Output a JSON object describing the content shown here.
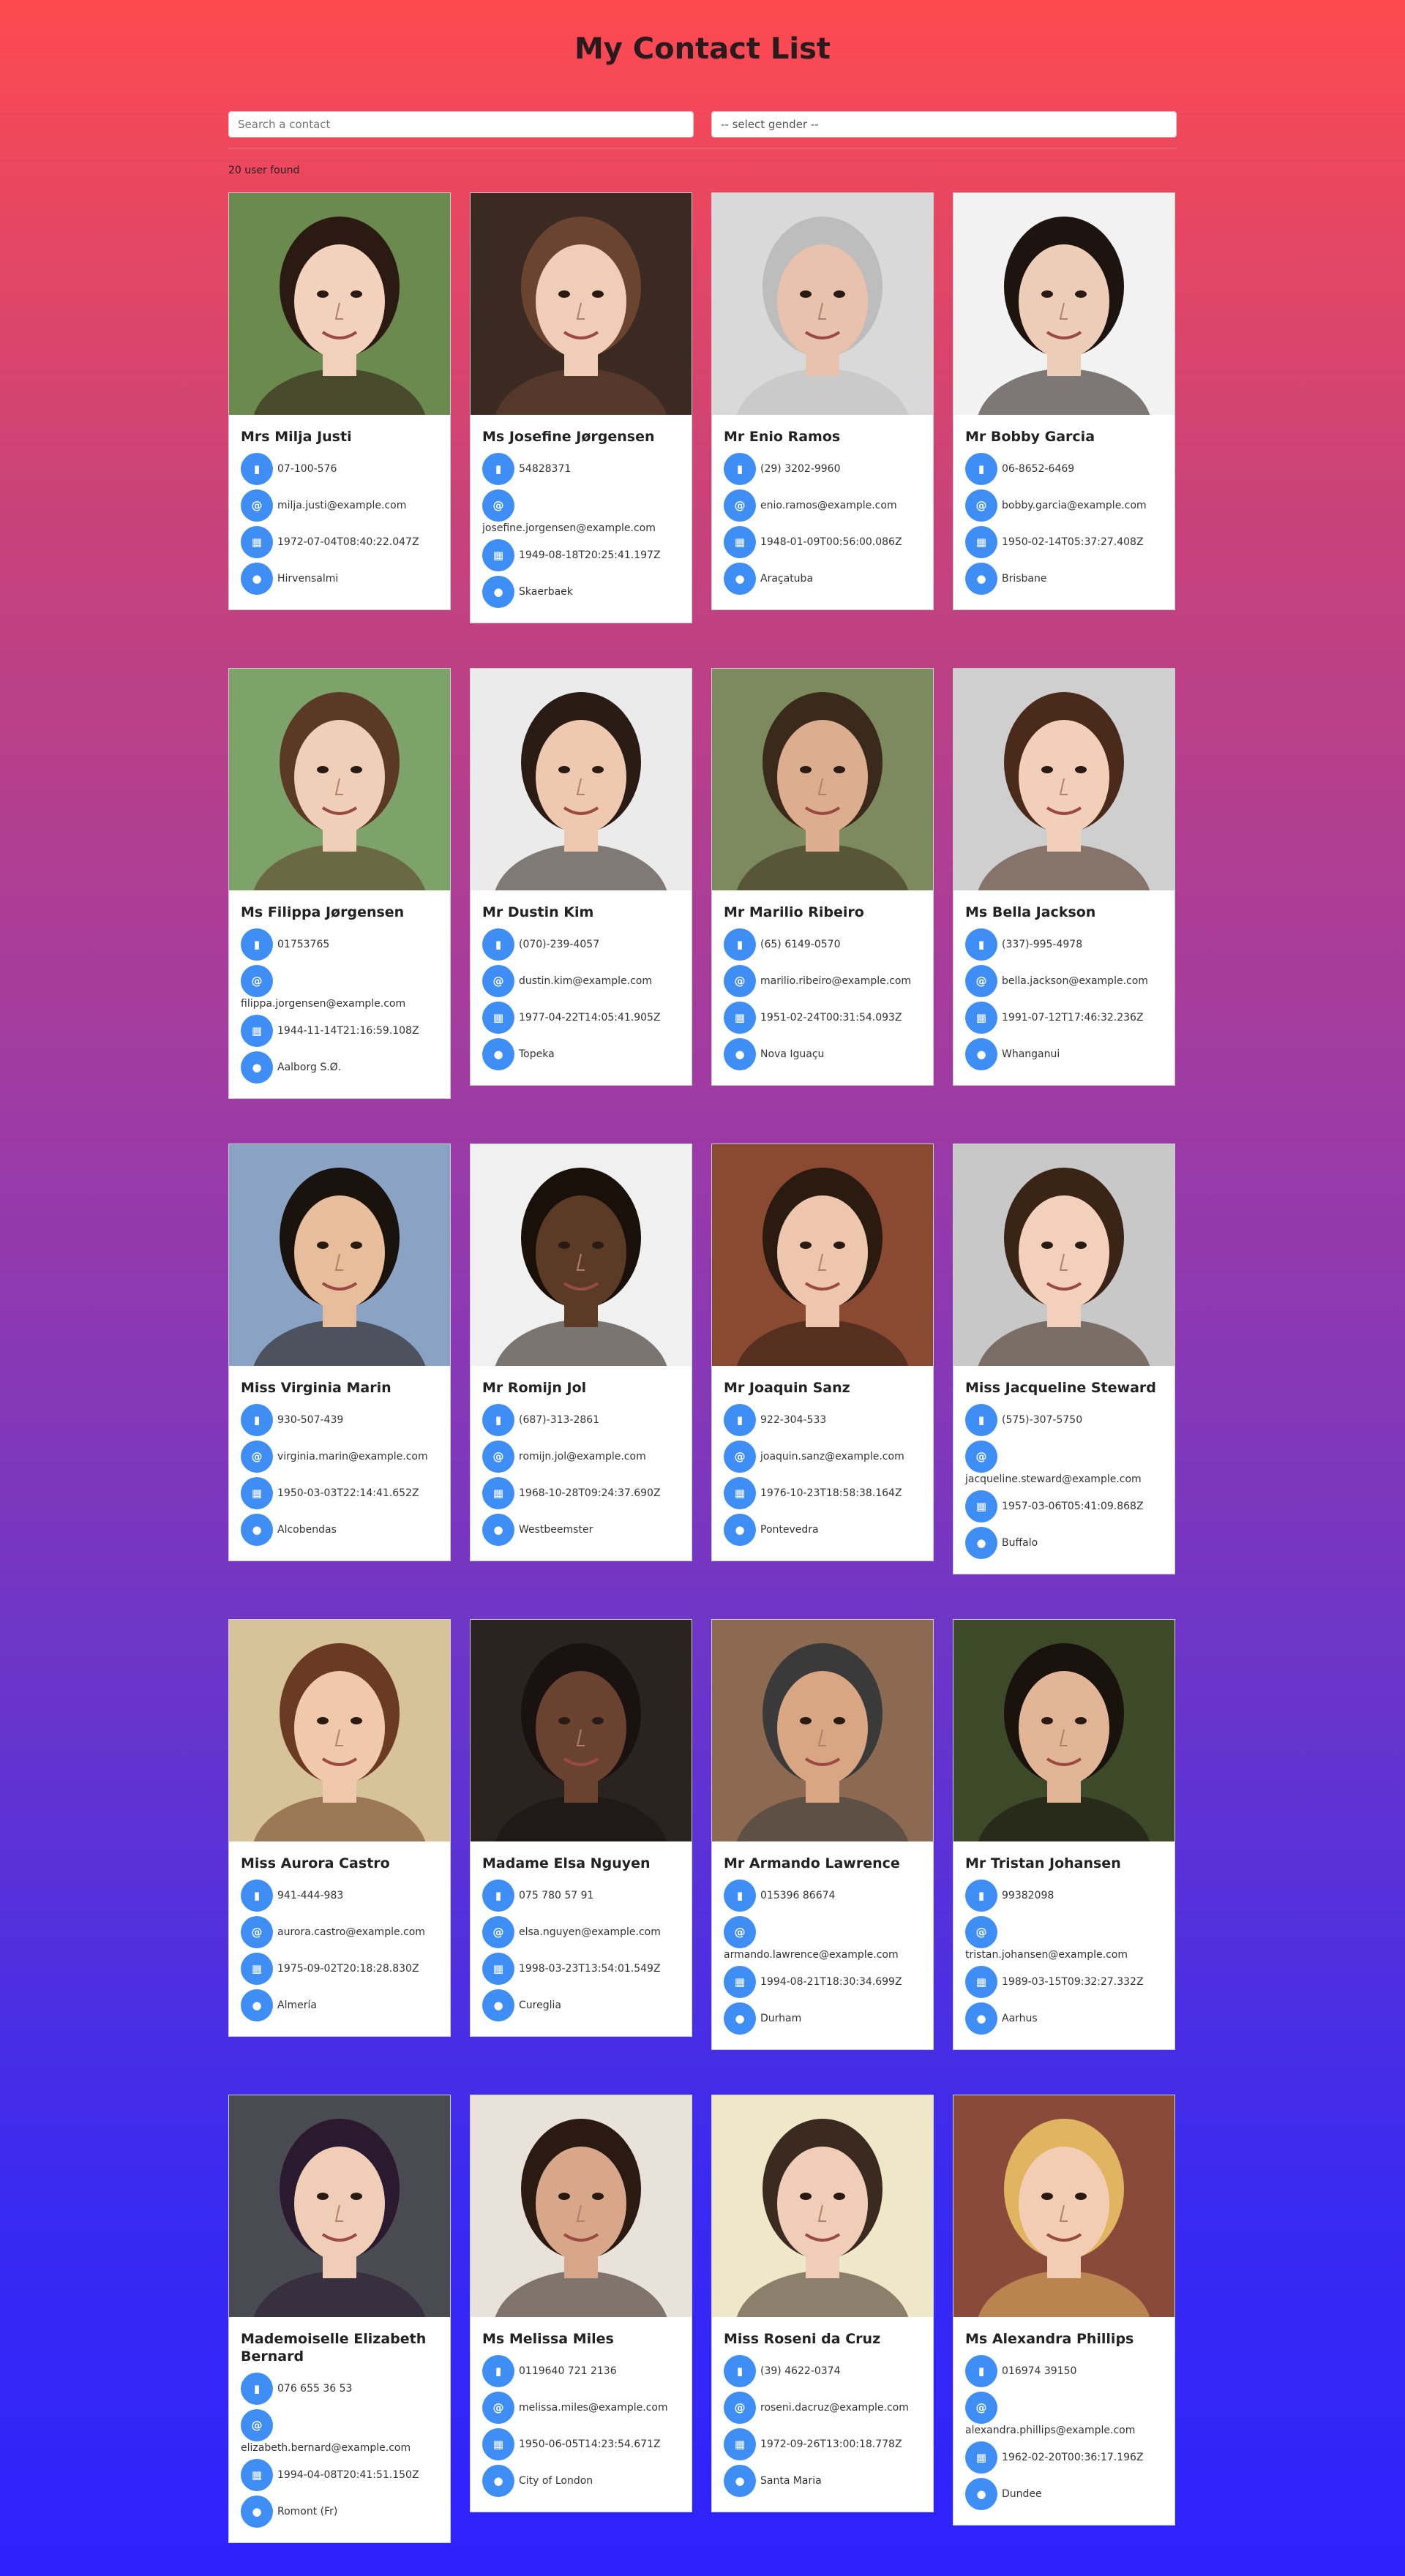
{
  "page": {
    "title": "My Contact List"
  },
  "search": {
    "placeholder": "Search a contact"
  },
  "gender_select": {
    "selected": "-- select gender --"
  },
  "result_count": "20 user found",
  "accent": "#3e8ef5",
  "contacts": [
    {
      "name": "Mrs Milja Justi",
      "phone": "07-100-576",
      "email": "milja.justi@example.com",
      "dob": "1972-07-04T08:40:22.047Z",
      "city": "Hirvensalmi",
      "bg": "#6b8a4e",
      "skin": "#f3d2bd",
      "hair": "#2b1a12"
    },
    {
      "name": "Ms Josefine Jørgensen",
      "phone": "54828371",
      "email": "josefine.jorgensen@example.com",
      "dob": "1949-08-18T20:25:41.197Z",
      "city": "Skaerbaek",
      "bg": "#3a2a22",
      "skin": "#f0cdb6",
      "hair": "#6b4430"
    },
    {
      "name": "Mr Enio Ramos",
      "phone": "(29) 3202-9960",
      "email": "enio.ramos@example.com",
      "dob": "1948-01-09T00:56:00.086Z",
      "city": "Araçatuba",
      "bg": "#d9d9d9",
      "skin": "#e8c2ac",
      "hair": "#bdbdbd"
    },
    {
      "name": "Mr Bobby Garcia",
      "phone": "06-8652-6469",
      "email": "bobby.garcia@example.com",
      "dob": "1950-02-14T05:37:27.408Z",
      "city": "Brisbane",
      "bg": "#f2f2f2",
      "skin": "#eecdb8",
      "hair": "#1e140f"
    },
    {
      "name": "Ms Filippa Jørgensen",
      "phone": "01753765",
      "email": "filippa.jorgensen@example.com",
      "dob": "1944-11-14T21:16:59.108Z",
      "city": "Aalborg S.Ø.",
      "bg": "#7ea36a",
      "skin": "#f0cfb8",
      "hair": "#5a3a24"
    },
    {
      "name": "Mr Dustin Kim",
      "phone": "(070)-239-4057",
      "email": "dustin.kim@example.com",
      "dob": "1977-04-22T14:05:41.905Z",
      "city": "Topeka",
      "bg": "#ebebeb",
      "skin": "#eec9b0",
      "hair": "#2a1c14"
    },
    {
      "name": "Mr Marilio Ribeiro",
      "phone": "(65) 6149-0570",
      "email": "marilio.ribeiro@example.com",
      "dob": "1951-02-24T00:31:54.093Z",
      "city": "Nova Iguaçu",
      "bg": "#7d8a5e",
      "skin": "#dcae8f",
      "hair": "#3a2a1c"
    },
    {
      "name": "Ms Bella Jackson",
      "phone": "(337)-995-4978",
      "email": "bella.jackson@example.com",
      "dob": "1991-07-12T17:46:32.236Z",
      "city": "Whanganui",
      "bg": "#cfcfcf",
      "skin": "#f2cfb9",
      "hair": "#4a2a1a"
    },
    {
      "name": "Miss Virginia Marin",
      "phone": "930-507-439",
      "email": "virginia.marin@example.com",
      "dob": "1950-03-03T22:14:41.652Z",
      "city": "Alcobendas",
      "bg": "#8aa2c4",
      "skin": "#e8bd9c",
      "hair": "#1a120c"
    },
    {
      "name": "Mr Romijn Jol",
      "phone": "(687)-313-2861",
      "email": "romijn.jol@example.com",
      "dob": "1968-10-28T09:24:37.690Z",
      "city": "Westbeemster",
      "bg": "#f0f0f0",
      "skin": "#5c3b26",
      "hair": "#1a100a"
    },
    {
      "name": "Mr Joaquin Sanz",
      "phone": "922-304-533",
      "email": "joaquin.sanz@example.com",
      "dob": "1976-10-23T18:58:38.164Z",
      "city": "Pontevedra",
      "bg": "#8a4a32",
      "skin": "#eec6ad",
      "hair": "#2a1a10"
    },
    {
      "name": "Miss Jacqueline Steward",
      "phone": "(575)-307-5750",
      "email": "jacqueline.steward@example.com",
      "dob": "1957-03-06T05:41:09.868Z",
      "city": "Buffalo",
      "bg": "#c8c8c8",
      "skin": "#f2d0bb",
      "hair": "#3a2416"
    },
    {
      "name": "Miss Aurora Castro",
      "phone": "941-444-983",
      "email": "aurora.castro@example.com",
      "dob": "1975-09-02T20:18:28.830Z",
      "city": "Almería",
      "bg": "#d6c39a",
      "skin": "#f0c9ad",
      "hair": "#6a3a22"
    },
    {
      "name": "Madame Elsa Nguyen",
      "phone": "075 780 57 91",
      "email": "elsa.nguyen@example.com",
      "dob": "1998-03-23T13:54:01.549Z",
      "city": "Cureglia",
      "bg": "#2a2320",
      "skin": "#6a4230",
      "hair": "#1a1210"
    },
    {
      "name": "Mr Armando Lawrence",
      "phone": "015396 86674",
      "email": "armando.lawrence@example.com",
      "dob": "1994-08-21T18:30:34.699Z",
      "city": "Durham",
      "bg": "#8c6a52",
      "skin": "#d9a684",
      "hair": "#3a3a3a"
    },
    {
      "name": "Mr Tristan Johansen",
      "phone": "99382098",
      "email": "tristan.johansen@example.com",
      "dob": "1989-03-15T09:32:27.332Z",
      "city": "Aarhus",
      "bg": "#3c4a2a",
      "skin": "#e2b596",
      "hair": "#1a120c"
    },
    {
      "name": "Mademoiselle Elizabeth Bernard",
      "phone": "076 655 36 53",
      "email": "elizabeth.bernard@example.com",
      "dob": "1994-04-08T20:41:51.150Z",
      "city": "Romont (Fr)",
      "bg": "#4a4a52",
      "skin": "#f0cdb6",
      "hair": "#2a1a30"
    },
    {
      "name": "Ms Melissa Miles",
      "phone": "0119640 721 2136",
      "email": "melissa.miles@example.com",
      "dob": "1950-06-05T14:23:54.671Z",
      "city": "City of London",
      "bg": "#e8e2da",
      "skin": "#d8a688",
      "hair": "#2a1a12"
    },
    {
      "name": "Miss Roseni da Cruz",
      "phone": "(39) 4622-0374",
      "email": "roseni.dacruz@example.com",
      "dob": "1972-09-26T13:00:18.778Z",
      "city": "Santa Maria",
      "bg": "#efe8c8",
      "skin": "#f0cdb6",
      "hair": "#3a2a20"
    },
    {
      "name": "Ms Alexandra Phillips",
      "phone": "016974 39150",
      "email": "alexandra.phillips@example.com",
      "dob": "1962-02-20T00:36:17.196Z",
      "city": "Dundee",
      "bg": "#8a4a3a",
      "skin": "#f2cdb4",
      "hair": "#e0b460"
    }
  ]
}
